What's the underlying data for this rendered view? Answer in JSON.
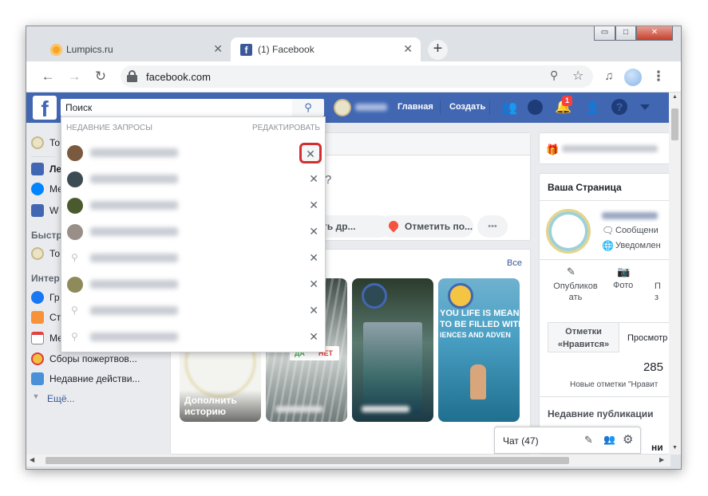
{
  "window": {
    "tabs": [
      {
        "title": "Lumpics.ru",
        "active": false
      },
      {
        "title": "(1) Facebook",
        "active": true
      }
    ],
    "new_tab": "+",
    "controls": {
      "minimize": "▭",
      "maximize": "□",
      "close": "✕"
    }
  },
  "toolbar": {
    "url": "facebook.com"
  },
  "fb": {
    "search_placeholder": "Поиск",
    "nav_home": "Главная",
    "nav_create": "Создать",
    "notif_count": "1"
  },
  "search_dropdown": {
    "header": "НЕДАВНИЕ ЗАПРОСЫ",
    "edit": "РЕДАКТИРОВАТЬ",
    "close": "✕",
    "rows": [
      {
        "kind": "person",
        "avatar_color": "#7a5a3e"
      },
      {
        "kind": "person",
        "avatar_color": "#3d4c52"
      },
      {
        "kind": "person",
        "avatar_color": "#4b5a2e"
      },
      {
        "kind": "person",
        "avatar_color": "#9a8f88"
      },
      {
        "kind": "query"
      },
      {
        "kind": "person",
        "avatar_color": "#8f8a5a"
      },
      {
        "kind": "query"
      },
      {
        "kind": "query"
      }
    ]
  },
  "sidebar": {
    "items": [
      {
        "label": "То",
        "icon": "profile-icon"
      },
      {
        "label": "Ле",
        "icon": "news-feed-icon"
      },
      {
        "label": "Ме",
        "icon": "messenger-icon"
      },
      {
        "label": "W",
        "icon": "watch-icon"
      },
      {
        "label": "Быстр",
        "icon": ""
      },
      {
        "label": "То",
        "icon": "profile-icon"
      },
      {
        "label": "Интер",
        "icon": ""
      },
      {
        "label": "Гр",
        "icon": "groups-icon"
      },
      {
        "label": "Ст",
        "icon": "pages-icon"
      },
      {
        "label": "Ме",
        "icon": "events-icon"
      },
      {
        "label": "Сборы пожертвов...",
        "icon": "fundraiser-icon"
      },
      {
        "label": "Недавние действи...",
        "icon": "recent-activity-icon"
      },
      {
        "label": "Ещё...",
        "icon": "chevron-down-icon"
      }
    ]
  },
  "composer": {
    "question_mark": "?",
    "tag_friends": "ть др...",
    "check_in": "Отметить по...",
    "more": "•••"
  },
  "stories": {
    "all": "Все",
    "add_story": "Дополнить историю",
    "yes": "ДА",
    "no": "НЕТ",
    "banner_lines": [
      "YOU LIFE IS MEAN",
      "TO BE FILLED WITH",
      "IENCES AND ADVEN"
    ]
  },
  "right": {
    "your_page_title": "Ваша Страница",
    "messages": "Сообщени",
    "notifications": "Уведомлен",
    "publish": "Опубликов ать",
    "photo": "Фото",
    "more_short": "П з",
    "likes_tab": "Отметки «Нравится»",
    "views_tab": "Просмотр",
    "likes_count": "285",
    "new_likes": "Новые отметки \"Нравит",
    "recent_posts": "Недавние публикации",
    "chat": "Чат (47)",
    "tail": "ни во"
  }
}
